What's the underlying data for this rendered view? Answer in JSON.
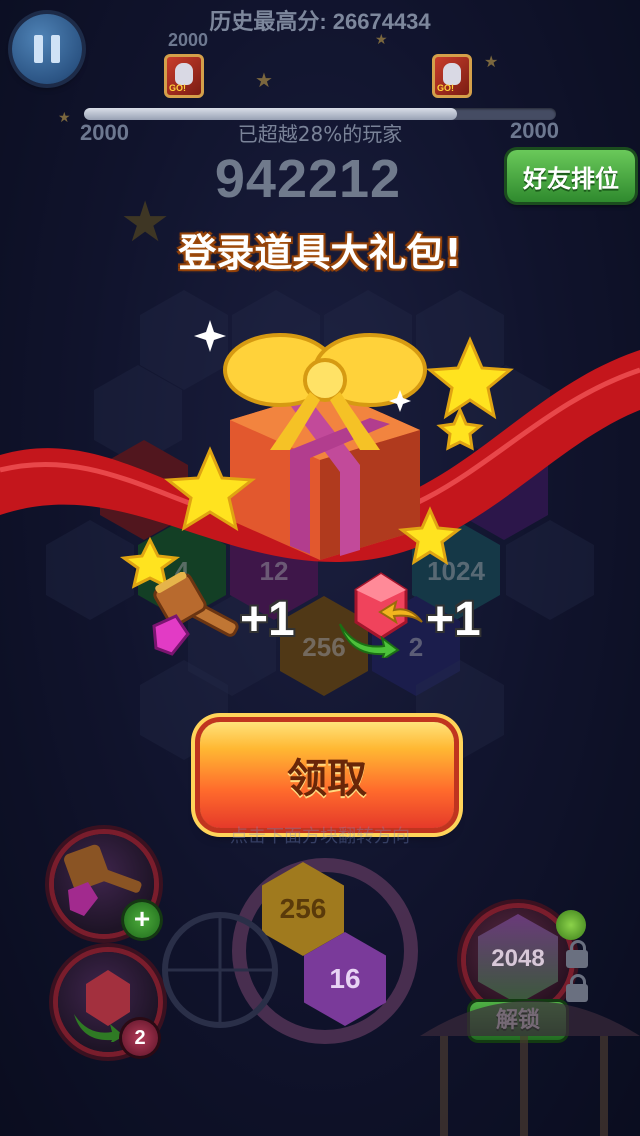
{
  "hud": {
    "high_score_text": "历史最高分: 26674434",
    "progress_left_top": "2000",
    "progress_left": "2000",
    "progress_right": "2000",
    "go_label": "GO!",
    "progress_fraction": 0.79,
    "surpass_text": "已超越28%的玩家",
    "current_score": "942212",
    "friends_button": "好友排位"
  },
  "popup": {
    "title": "登录道具大礼包!",
    "rewards": [
      {
        "icon": "hammer-icon",
        "count": "+1"
      },
      {
        "icon": "gem-icon",
        "count": "+1"
      }
    ],
    "claim_button": "领取",
    "hint": "点击下面方块翻转方向"
  },
  "board": {
    "tiles": [
      "64",
      "4",
      "12",
      "256",
      "1024",
      "2",
      "2048"
    ]
  },
  "bottom": {
    "hammer_badge": "+",
    "gem_count": "2",
    "next_tiles": [
      "256",
      "16"
    ],
    "unlock_tile": "2048",
    "unlock_button": "解锁"
  },
  "colors": {
    "claim_button": "#ff6a2c",
    "friends_button": "#2f8a2e",
    "ribbon": "#c4161c",
    "gift_box": "#e2582e",
    "bow": "#ffd23a"
  }
}
